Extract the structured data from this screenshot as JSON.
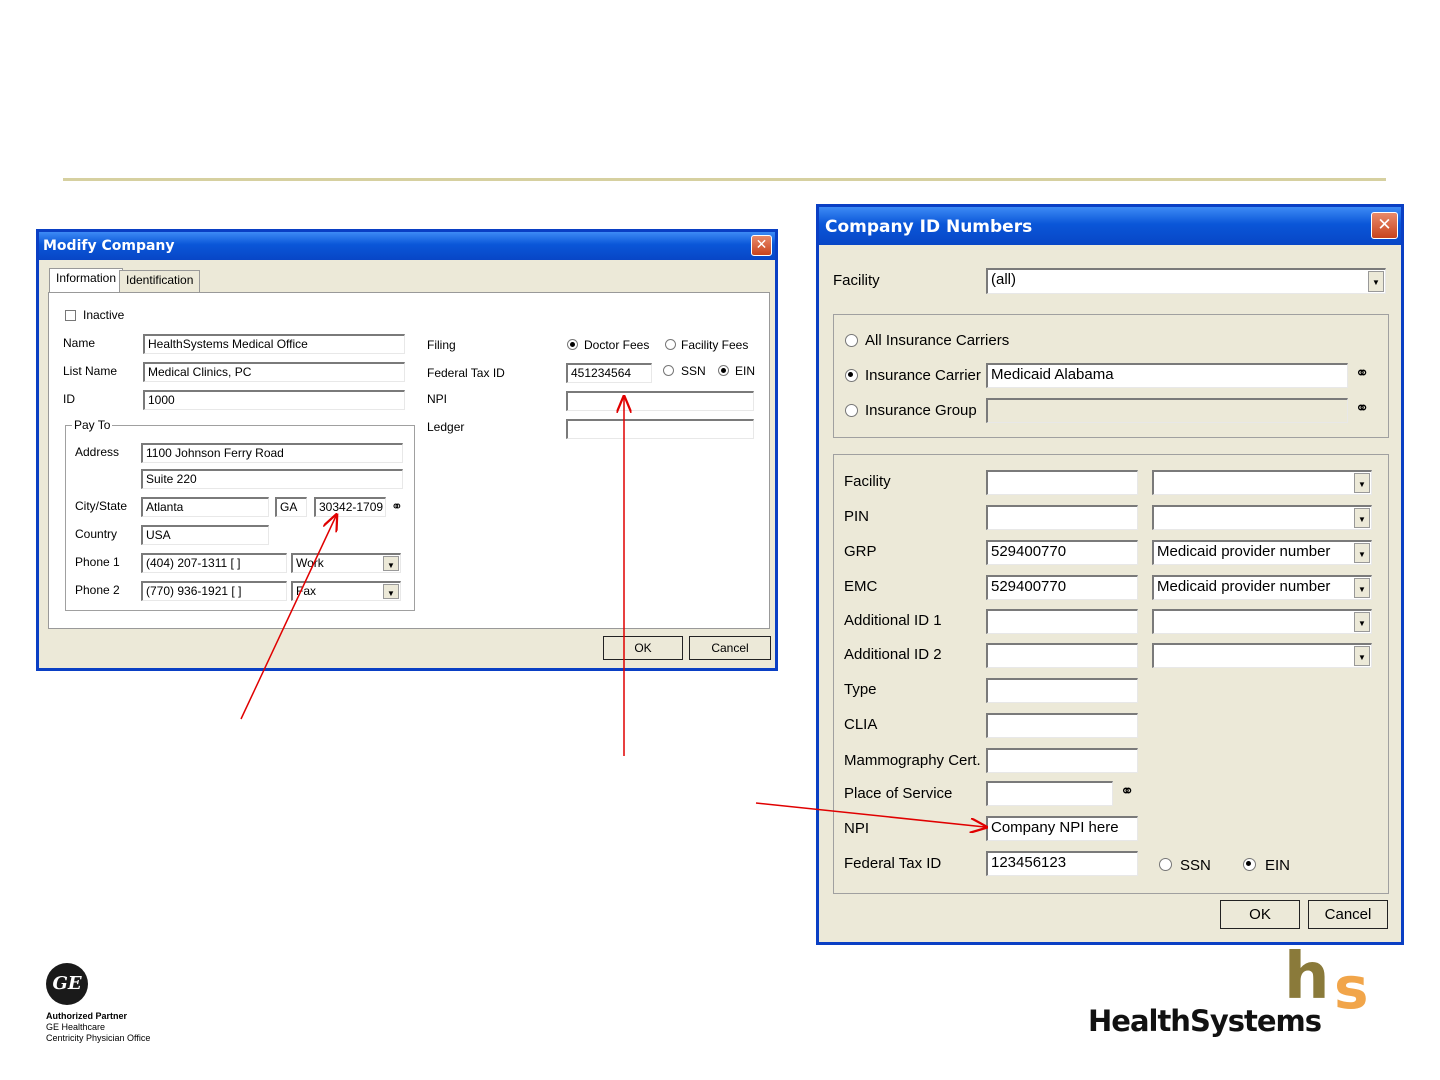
{
  "colors": {
    "accent_line": "#d6d0a0",
    "arrow": "#e00000",
    "title_blue": "#0a56d8",
    "hs_gold": "#8a7a3a",
    "hs_orange": "#f1a54a"
  },
  "modify_company": {
    "title": "Modify Company",
    "tabs": [
      "Information",
      "Identification"
    ],
    "inactive_label": "Inactive",
    "name_label": "Name",
    "name_value": "HealthSystems Medical Office",
    "list_name_label": "List Name",
    "list_name_value": "Medical Clinics, PC",
    "id_label": "ID",
    "id_value": "1000",
    "pay_to": {
      "legend": "Pay To",
      "address_label": "Address",
      "address1": "1100 Johnson Ferry Road",
      "address2": "Suite 220",
      "city_state_label": "City/State",
      "city": "Atlanta",
      "state": "GA",
      "zip": "30342-1709",
      "country_label": "Country",
      "country": "USA",
      "phone1_label": "Phone 1",
      "phone1": "(404) 207-1311 [    ]",
      "phone1_type": "Work",
      "phone2_label": "Phone 2",
      "phone2": "(770) 936-1921 [    ]",
      "phone2_type": "Fax"
    },
    "filing_label": "Filing",
    "filing_doctor": "Doctor Fees",
    "filing_facility": "Facility Fees",
    "federal_tax_label": "Federal Tax ID",
    "federal_tax_value": "451234564",
    "ssn_label": "SSN",
    "ein_label": "EIN",
    "npi_label": "NPI",
    "npi_value": "",
    "ledger_label": "Ledger",
    "ledger_value": "",
    "ok_label": "OK",
    "cancel_label": "Cancel"
  },
  "company_ids": {
    "title": "Company ID Numbers",
    "facility_label": "Facility",
    "facility_value": "(all)",
    "all_carriers_label": "All Insurance Carriers",
    "carrier_label": "Insurance Carrier",
    "carrier_value": "Medicaid Alabama",
    "group_label": "Insurance Group",
    "group_value": "",
    "rows": [
      {
        "label": "Facility",
        "value": "",
        "desc": ""
      },
      {
        "label": "PIN",
        "value": "",
        "desc": ""
      },
      {
        "label": "GRP",
        "value": "529400770",
        "desc": "Medicaid provider number"
      },
      {
        "label": "EMC",
        "value": "529400770",
        "desc": "Medicaid provider number"
      },
      {
        "label": "Additional ID 1",
        "value": "",
        "desc": ""
      },
      {
        "label": "Additional ID 2",
        "value": "",
        "desc": ""
      }
    ],
    "type_label": "Type",
    "type_value": "",
    "clia_label": "CLIA",
    "clia_value": "",
    "mammo_label": "Mammography Cert.",
    "mammo_value": "",
    "pos_label": "Place of Service",
    "pos_value": "",
    "npi_label": "NPI",
    "npi_value": "Company NPI here",
    "federal_tax_label": "Federal Tax ID",
    "federal_tax_value": "123456123",
    "ssn_label": "SSN",
    "ein_label": "EIN",
    "ok_label": "OK",
    "cancel_label": "Cancel"
  },
  "ge_logo": {
    "text": "GE",
    "line1": "Authorized Partner",
    "line2": "GE Healthcare",
    "line3": "Centricity Physician Office"
  },
  "hs_logo": {
    "wordmark": "HealthSystems",
    "glyph_h": "h",
    "glyph_s": "s"
  }
}
